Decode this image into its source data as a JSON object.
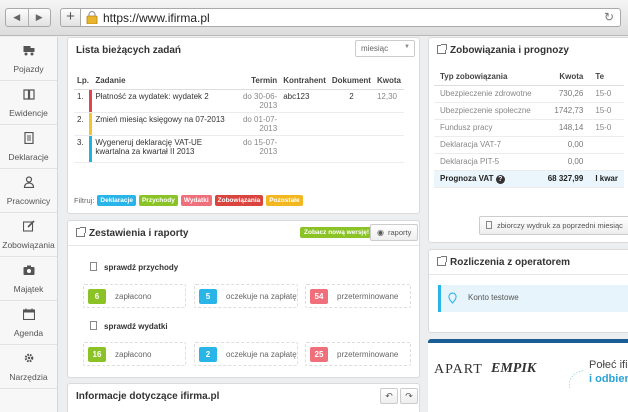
{
  "browser": {
    "url": "https://www.ifirma.pl"
  },
  "sidebar": {
    "items": [
      {
        "label": "Pojazdy",
        "icon": "truck-icon"
      },
      {
        "label": "Ewidencje",
        "icon": "book-icon"
      },
      {
        "label": "Deklaracje",
        "icon": "document-icon"
      },
      {
        "label": "Pracownicy",
        "icon": "people-icon"
      },
      {
        "label": "Zobowiązania",
        "icon": "pencil-icon"
      },
      {
        "label": "Majątek",
        "icon": "camera-icon"
      },
      {
        "label": "Agenda",
        "icon": "calendar-icon"
      },
      {
        "label": "Narzędzia",
        "icon": "gear-icon"
      }
    ]
  },
  "tasks": {
    "title": "Lista bieżących zadań",
    "period": "miesiąc",
    "columns": [
      "Lp.",
      "Zadanie",
      "Termin",
      "Kontrahent",
      "Dokument",
      "Kwota"
    ],
    "rows": [
      {
        "lp": "1.",
        "color": "#e0454f",
        "task": "Płatność za wydatek: wydatek 2",
        "due": "do 30-06-2013",
        "contractor": "abc123",
        "doc": "2",
        "amount": "12,30"
      },
      {
        "lp": "2.",
        "color": "#f2c42e",
        "task": "Zmień miesiąc księgowy na 07-2013",
        "due": "do 01-07-2013",
        "contractor": "",
        "doc": "",
        "amount": ""
      },
      {
        "lp": "3.",
        "color": "#21b3e0",
        "task": "Wygeneruj deklarację VAT-UE kwartalna za kwartał II 2013",
        "due": "do 15-07-2013",
        "contractor": "",
        "doc": "",
        "amount": ""
      }
    ],
    "filter_label": "Filtruj:",
    "filters": [
      {
        "label": "Deklaracje",
        "color": "#29b5e8"
      },
      {
        "label": "Przychody",
        "color": "#8bc326"
      },
      {
        "label": "Wydatki",
        "color": "#ef6f7b"
      },
      {
        "label": "Zobowiązania",
        "color": "#d9443e"
      },
      {
        "label": "Pozostałe",
        "color": "#f3b81f"
      }
    ]
  },
  "reports": {
    "title": "Zestawienia i raporty",
    "new_version": "Zobacz nową wersję!",
    "raporty": "raporty",
    "income_label": "sprawdź przychody",
    "expenses_label": "sprawdź wydatki",
    "income_stats": [
      {
        "value": "6",
        "label": "zapłacono",
        "color": "#8bc326"
      },
      {
        "value": "5",
        "label": "oczekuje na zapłatę",
        "color": "#29b5e8"
      },
      {
        "value": "54",
        "label": "przeterminowane",
        "color": "#ef6f7b"
      }
    ],
    "expense_stats": [
      {
        "value": "16",
        "label": "zapłacono",
        "color": "#8bc326"
      },
      {
        "value": "2",
        "label": "oczekuje na zapłatę",
        "color": "#29b5e8"
      },
      {
        "value": "25",
        "label": "przeterminowane",
        "color": "#ef6f7b"
      }
    ]
  },
  "info": {
    "title": "Informacje dotyczące ifirma.pl"
  },
  "obligations": {
    "title": "Zobowiązania i prognozy",
    "columns": [
      "Typ zobowiązania",
      "Kwota",
      "Te"
    ],
    "rows": [
      {
        "type": "Ubezpieczenie zdrowotne",
        "amount": "730,26",
        "date": "15-0"
      },
      {
        "type": "Ubezpieczenie społeczne",
        "amount": "1742,73",
        "date": "15-0"
      },
      {
        "type": "Fundusz pracy",
        "amount": "148,14",
        "date": "15-0"
      },
      {
        "type": "Deklaracja VAT-7",
        "amount": "0,00",
        "date": ""
      },
      {
        "type": "Deklaracja PIT-5",
        "amount": "0,00",
        "date": ""
      }
    ],
    "vat": {
      "type": "Prognoza VAT",
      "amount": "68 327,99",
      "date": "I kwar"
    },
    "print_button": "zbiorczy wydruk za poprzedni miesiąc"
  },
  "operator": {
    "title": "Rozliczenia z operatorem",
    "account": "Konto testowe"
  },
  "banner": {
    "brand1": "APART",
    "brand2": "EMPIK",
    "line1": "Połeć ifir",
    "line2": "i odbiera"
  }
}
